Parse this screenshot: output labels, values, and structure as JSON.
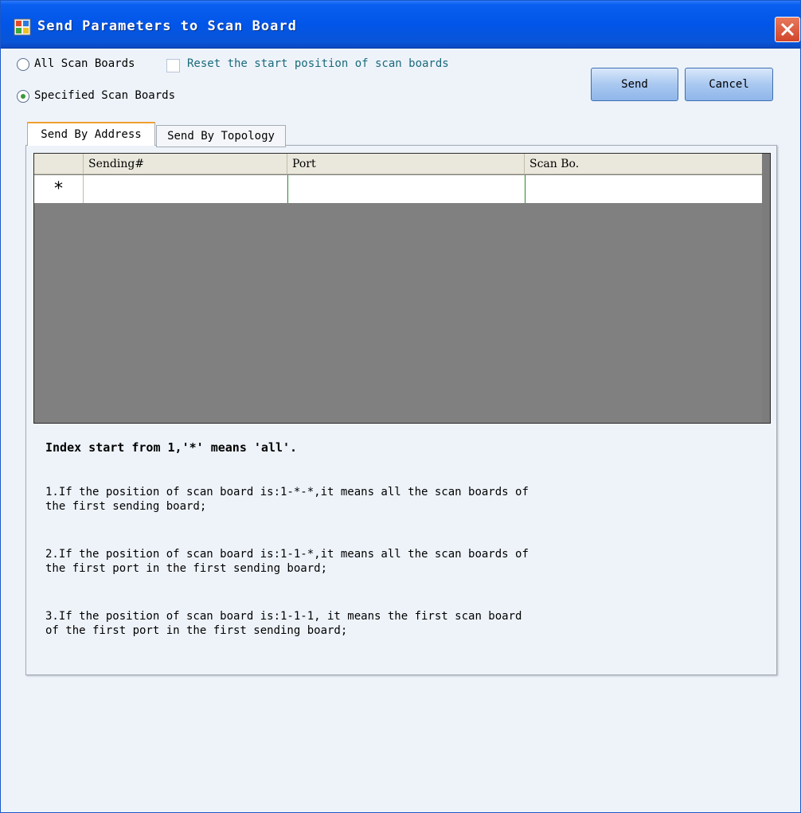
{
  "window": {
    "title": "Send Parameters to Scan Board"
  },
  "options": {
    "all_scan_boards_label": "All Scan Boards",
    "reset_start_position_label": "Reset the start position of scan boards",
    "specified_scan_boards_label": "Specified Scan Boards",
    "selected": "specified"
  },
  "buttons": {
    "send_label": "Send",
    "cancel_label": "Cancel"
  },
  "tabs": [
    {
      "label": "Send By Address",
      "active": true
    },
    {
      "label": "Send By Topology",
      "active": false
    }
  ],
  "grid": {
    "columns": [
      "Sending#",
      "Port",
      "Scan Bo."
    ],
    "new_row_marker": "*"
  },
  "notes": {
    "title": "Index start from 1,'*' means 'all'.",
    "items": [
      "1.If the position of scan board is:1-*-*,it means all the scan boards of\nthe first sending board;",
      "2.If the position of scan board is:1-1-*,it means all the scan boards of\nthe first port in the first sending board;",
      "3.If the position of scan board is:1-1-1, it means the first scan board\nof the first port in the first sending board;"
    ]
  },
  "icons": {
    "app": "app-icon",
    "close": "close-icon"
  },
  "colors": {
    "titlebar": "#0155e8",
    "close": "#d0452a",
    "radio_checked": "#3a9a3a",
    "grid_background": "#808080"
  }
}
